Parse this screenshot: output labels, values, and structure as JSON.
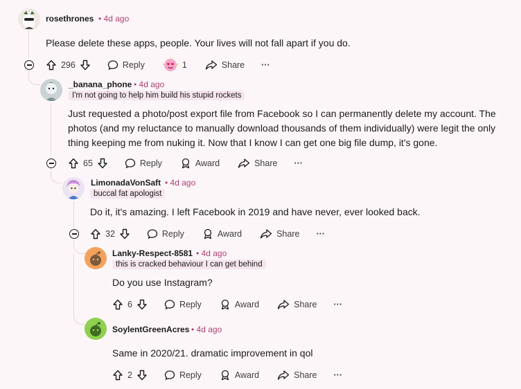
{
  "comments": [
    {
      "author": "rosethrones",
      "time": "4d ago",
      "flair": "",
      "body": "Please delete these apps, people. Your lives will not fall apart if you do.",
      "votes": "296",
      "award_count": "1",
      "reply_label": "Reply",
      "share_label": "Share",
      "more_label": "···"
    },
    {
      "author": "_banana_phone",
      "time": "4d ago",
      "flair": "I'm not going to help him build his stupid rockets",
      "body": "Just requested a photo/post export file from Facebook so I can permanently delete my account. The photos (and my reluctance to manually download thousands of them individually) were legit the only thing keeping me from nuking it. Now that I know I can get one big file dump, it's gone.",
      "votes": "65",
      "reply_label": "Reply",
      "award_label": "Award",
      "share_label": "Share",
      "more_label": "···"
    },
    {
      "author": "LimonadaVonSaft",
      "time": "4d ago",
      "flair": "buccal fat apologist",
      "body": "Do it, it's amazing. I left Facebook in 2019 and have never, ever looked back.",
      "votes": "32",
      "reply_label": "Reply",
      "award_label": "Award",
      "share_label": "Share",
      "more_label": "···"
    },
    {
      "author": "Lanky-Respect-8581",
      "time": "4d ago",
      "flair": "this is cracked behaviour I can get behind",
      "body": "Do you use Instagram?",
      "votes": "6",
      "reply_label": "Reply",
      "award_label": "Award",
      "share_label": "Share",
      "more_label": "···"
    },
    {
      "author": "SoylentGreenAcres",
      "time": "4d ago",
      "flair": "",
      "body": "Same in 2020/21. dramatic improvement in qol",
      "votes": "2",
      "reply_label": "Reply",
      "award_label": "Award",
      "share_label": "Share",
      "more_label": "···"
    }
  ],
  "separator": "•",
  "colors": {
    "time": "#b0406f",
    "background": "#fcf6f9",
    "thread_line": "#e6d6de"
  }
}
